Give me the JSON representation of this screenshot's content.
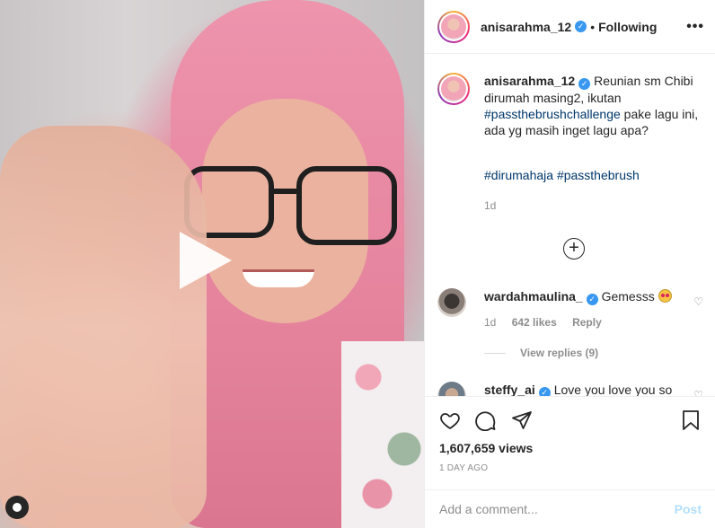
{
  "post": {
    "username": "anisarahma_12",
    "separator": "•",
    "follow_status": "Following",
    "more": "•••"
  },
  "caption": {
    "username": "anisarahma_12",
    "text_1": " Reunian sm Chibi dirumah masing2, ikutan ",
    "tag_1": "#passthebrushchallenge",
    "text_2": " pake lagu ini, ada yg masih inget lagu apa?",
    "hashtags": "#dirumahaja #passthebrush",
    "time": "1d"
  },
  "comments": [
    {
      "username": "wardahmaulina_",
      "text": " Gemesss",
      "time": "1d",
      "likes": "642 likes",
      "reply": "Reply",
      "view_replies": "View replies (9)"
    },
    {
      "username": "steffy_ai",
      "text": " Love you love you so"
    }
  ],
  "stats": {
    "views": "1,607,659 views",
    "posted": "1 DAY AGO"
  },
  "add_comment": {
    "placeholder": "Add a comment...",
    "post_label": "Post"
  },
  "colors": {
    "verified": "#3897f0",
    "hashtag": "#00376b",
    "secondary_text": "#8e8e8e",
    "post_button": "#b2dffc"
  },
  "icons": [
    "play-icon",
    "verified-icon",
    "more-icon",
    "add-comments-icon",
    "heart-icon",
    "comment-icon",
    "share-icon",
    "save-icon",
    "media-profile-icon",
    "emoji-icon"
  ]
}
